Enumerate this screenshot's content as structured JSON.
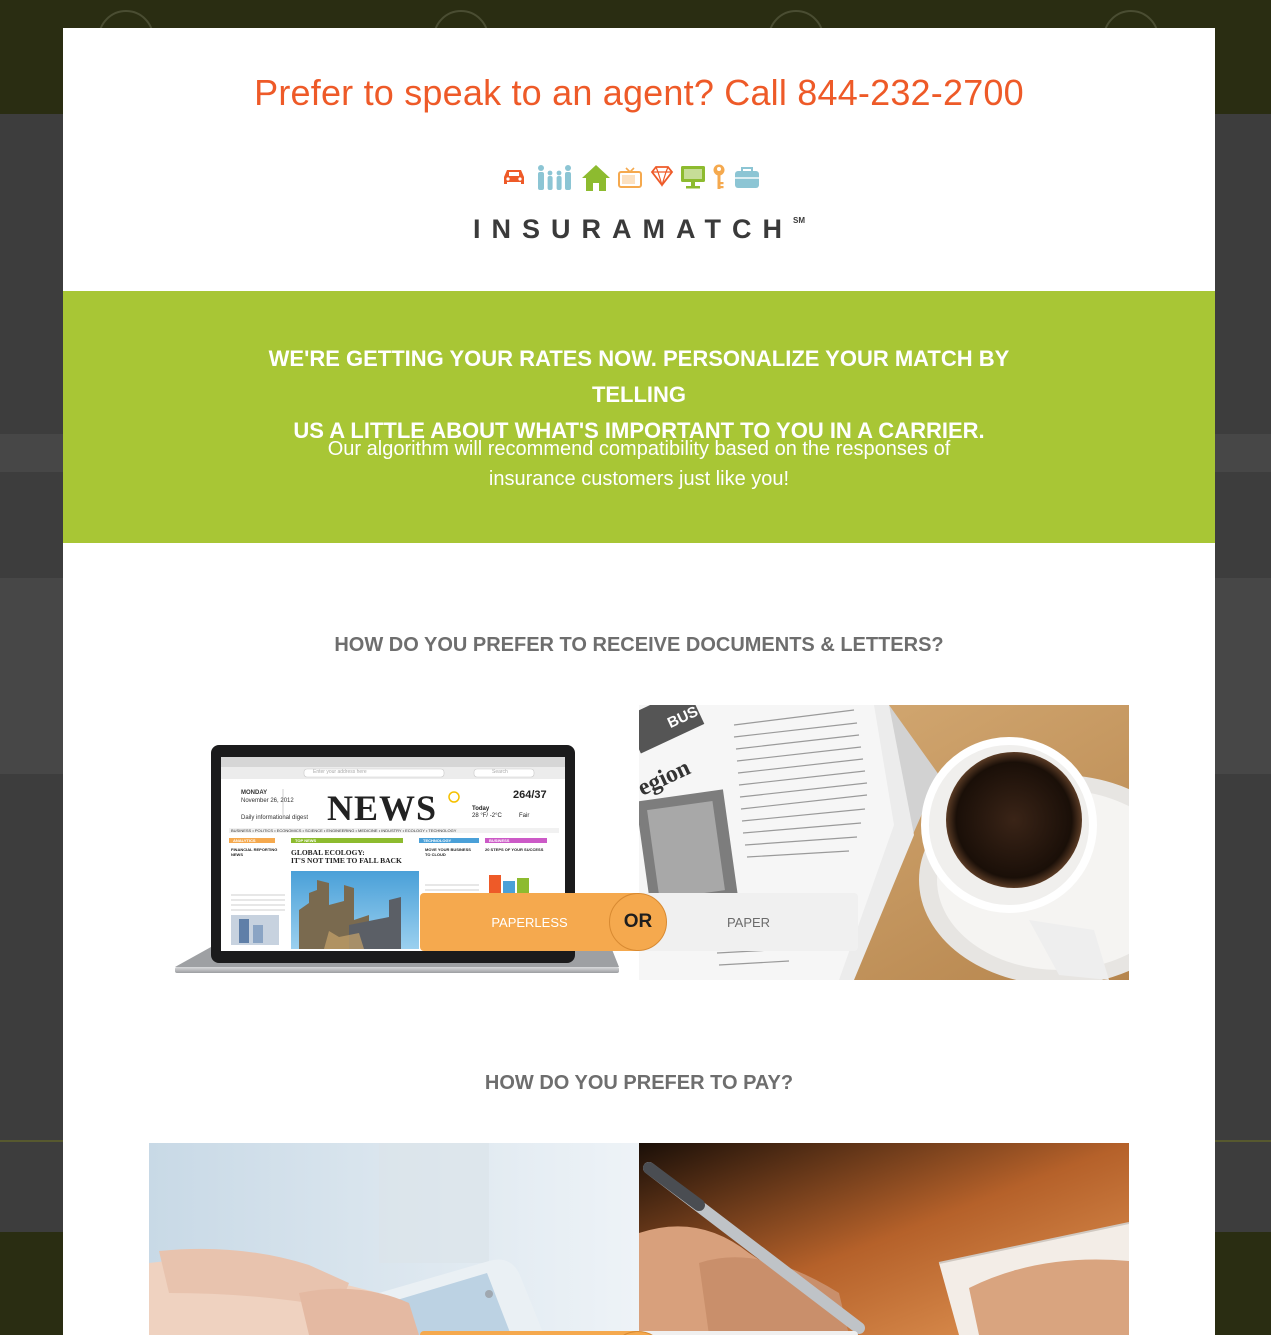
{
  "header": {
    "call_text": "Prefer to speak to an agent? Call 844-232-2700"
  },
  "icons": [
    "car-icon",
    "family-icon",
    "home-icon",
    "tv-icon",
    "diamond-icon",
    "computer-icon",
    "key-icon",
    "bag-icon"
  ],
  "brand": {
    "name": "INSURAMATCH",
    "mark": "SM"
  },
  "intro": {
    "headline_line1": "WE'RE GETTING YOUR RATES NOW. PERSONALIZE YOUR MATCH BY TELLING",
    "headline_line2": "US A LITTLE ABOUT WHAT'S IMPORTANT TO YOU IN A CARRIER.",
    "subtext_line1": "Our algorithm will recommend compatibility based on the responses of",
    "subtext_line2": "insurance customers just like you!"
  },
  "questions": [
    {
      "title": "HOW DO YOU PREFER TO RECEIVE DOCUMENTS & LETTERS?",
      "left_option": "PAPERLESS",
      "right_option": "PAPER",
      "or_label": "OR",
      "selected": "PAPERLESS",
      "laptop": {
        "masthead": "NEWS",
        "date_line1": "MONDAY",
        "date_line2": "November 26, 2012",
        "issue": "264/37",
        "digest": "Daily informational digest",
        "today_label": "Today",
        "temp": "28 °F/ -2°C",
        "weather": "Fair",
        "headline1": "GLOBAL ECOLOGY:",
        "headline2": "IT'S NOT TIME TO FALL BACK",
        "nav": "BUSINESS • POLITICS • ECONOMICS • SCIENCE • ENGINEERING • MEDICINE • INDUSTRY • ECOLOGY • TECHNOLOGY",
        "search_placeholder": "Enter your address here",
        "search_button": "Search",
        "section_analytics": "ANALYTICS",
        "section_topnews": "TOP NEWS",
        "section_technology": "TECHNOLOGY",
        "section_business": "BUSINESS",
        "col1_heading": "FINANCIAL REPORTING NEWS",
        "col3_heading": "MOVE YOUR BUSINESS TO CLOUD",
        "col4_heading": "20 STEPS OF YOUR SUCCESS"
      },
      "paper_photo": {
        "headline_fragment": "egion",
        "tab_fragment": "BUS"
      }
    },
    {
      "title": "HOW DO YOU PREFER TO PAY?"
    }
  ],
  "colors": {
    "accent_orange": "#ee5a28",
    "brand_green": "#a8c635",
    "toggle_selected": "#f5a94e",
    "toggle_unselected": "#f0f0f0"
  }
}
